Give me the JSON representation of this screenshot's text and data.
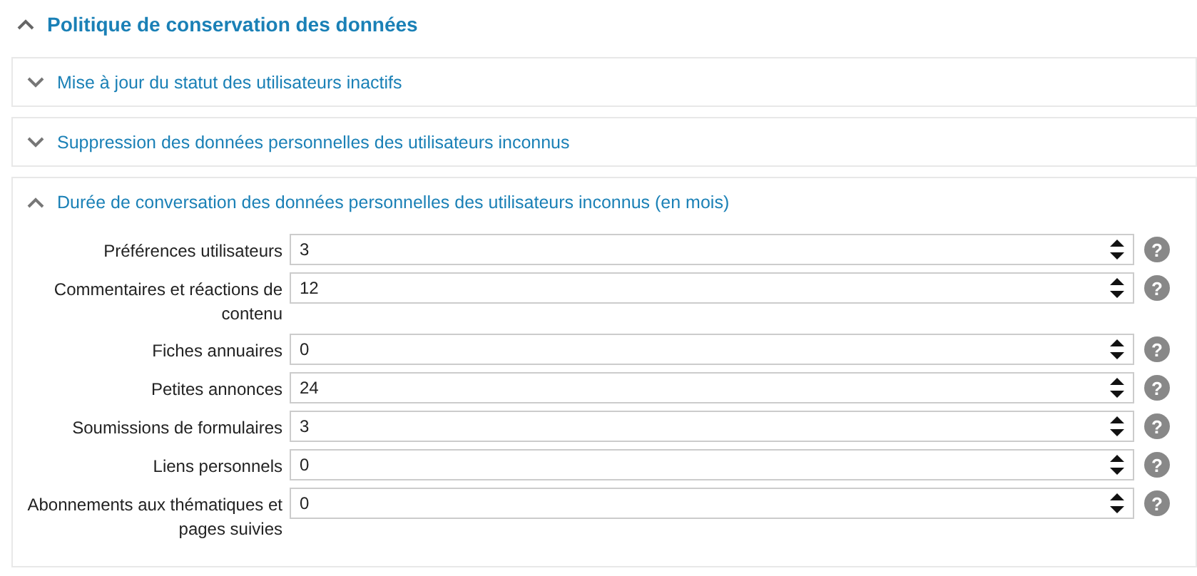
{
  "title": "Politique de conservation des données",
  "expanded": true,
  "sections": [
    {
      "title": "Mise à jour du statut des utilisateurs inactifs",
      "expanded": false
    },
    {
      "title": "Suppression des données personnelles des utilisateurs inconnus",
      "expanded": false
    },
    {
      "title": "Durée de conversation des données personnelles des utilisateurs inconnus (en mois)",
      "expanded": true,
      "fields": [
        {
          "label": "Préférences utilisateurs",
          "value": "3",
          "help": "?"
        },
        {
          "label": "Commentaires et réactions de contenu",
          "value": "12",
          "help": "?"
        },
        {
          "label": "Fiches annuaires",
          "value": "0",
          "help": "?"
        },
        {
          "label": "Petites annonces",
          "value": "24",
          "help": "?"
        },
        {
          "label": "Soumissions de formulaires",
          "value": "3",
          "help": "?"
        },
        {
          "label": "Liens personnels",
          "value": "0",
          "help": "?"
        },
        {
          "label": "Abonnements aux thématiques et pages suivies",
          "value": "0",
          "help": "?"
        }
      ]
    }
  ]
}
